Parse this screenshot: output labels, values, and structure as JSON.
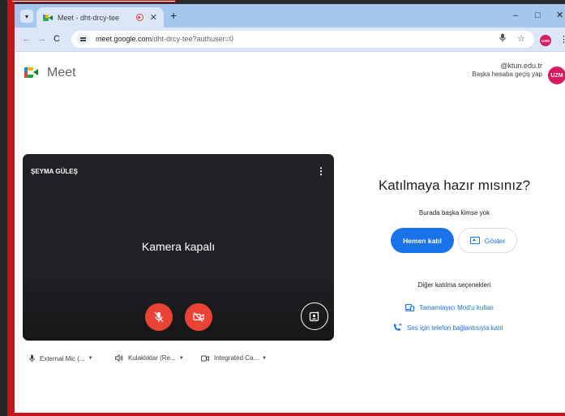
{
  "browser": {
    "tab_title": "Meet - dht-drcy-tee",
    "url_host": "meet.google.com",
    "url_path": "/dht-drcy-tee?authuser=0",
    "profile_initials": "UZM",
    "window_controls": {
      "minimize": "–",
      "maximize": "□",
      "close": "✕"
    },
    "new_tab_symbol": "+",
    "tab_close_symbol": "✕"
  },
  "meet": {
    "logo_text": "Meet",
    "account": {
      "email": "@ktun.edu.tr",
      "switch_label": "Başka hesaba geçiş yap",
      "avatar_initials": "UZM"
    },
    "preview": {
      "participant_name": "ŞEYMA GÜLEŞ",
      "camera_status": "Kamera kapalı"
    },
    "devices": [
      {
        "icon": "mic-icon",
        "label": "External Mic (..."
      },
      {
        "icon": "speaker-icon",
        "label": "Kulaklıklar (Re..."
      },
      {
        "icon": "camera-icon",
        "label": "Integrated Ca..."
      }
    ],
    "join_panel": {
      "title": "Katılmaya hazır mısınız?",
      "status": "Burada başka kimse yok",
      "join_label": "Hemen katıl",
      "present_label": "Göster",
      "other_options_title": "Diğer katılma seçenekleri",
      "companion_mode_label": "Tamamlayıcı Mod'u kullan",
      "phone_audio_label": "Ses için telefon bağlantısıyla katıl"
    }
  },
  "colors": {
    "frame_red": "#c2161c",
    "tabstrip": "#a5c6ef",
    "toolbar": "#dbe7f7",
    "primary_blue": "#1a73e8",
    "danger_red": "#ea4335",
    "avatar_pink": "#d81b60",
    "preview_bg": "#202124"
  }
}
